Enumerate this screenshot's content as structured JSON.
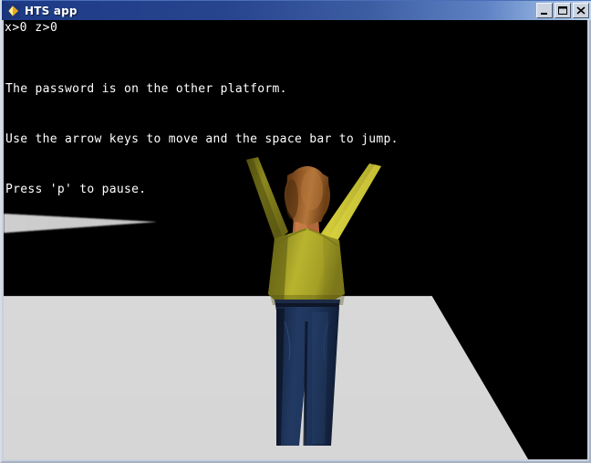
{
  "window": {
    "title": "HTS app",
    "icon": "app-diamond-icon",
    "controls": [
      {
        "name": "minimize-button",
        "glyph": "minimize"
      },
      {
        "name": "maximize-button",
        "glyph": "maximize"
      },
      {
        "name": "close-button",
        "glyph": "close"
      }
    ]
  },
  "hud": {
    "coords": "x>0 z>0",
    "messages": [
      "The password is on the other platform.",
      "Use the arrow keys to move and the space bar to jump.",
      "Press 'p' to pause."
    ]
  },
  "scene": {
    "background_color": "#000000",
    "platform_color": "#b9b9b9",
    "far_platform_color": "#9a9a9a",
    "character": {
      "shirt_color": "#b6b12c",
      "shirt_shadow_color": "#6d6a18",
      "hair_color": "#9d5d28",
      "skin_color": "#c6713c",
      "jeans_color": "#1d3358",
      "pose": "arms-raised"
    }
  }
}
